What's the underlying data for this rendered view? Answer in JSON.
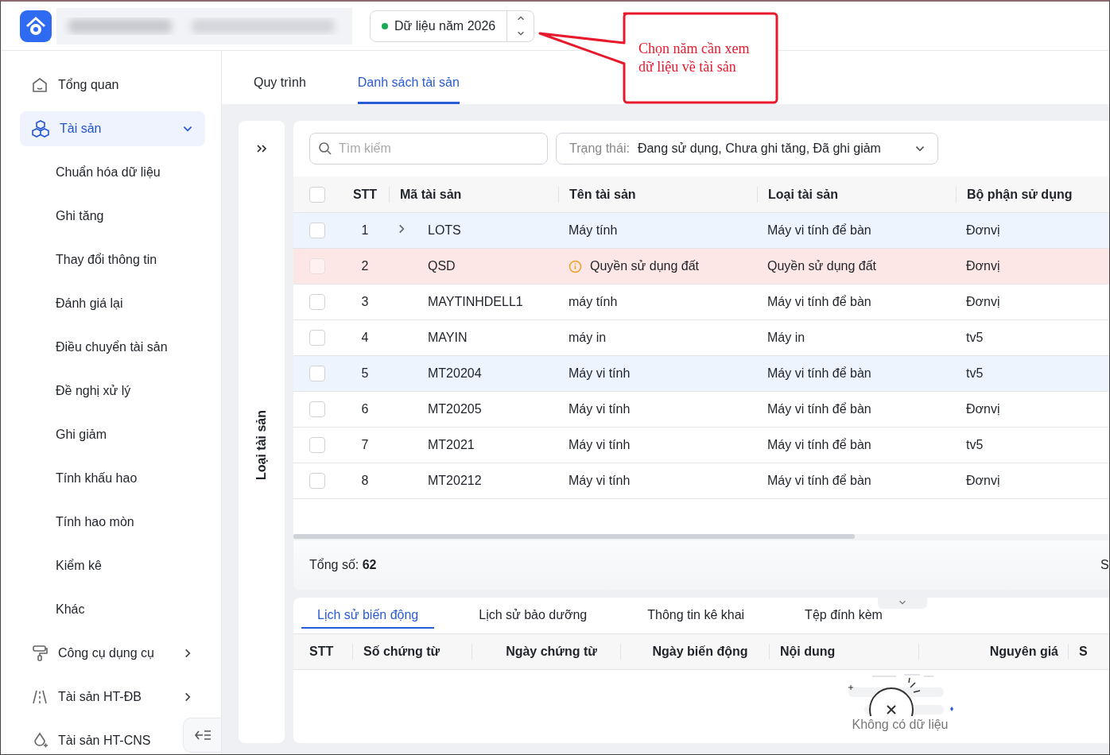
{
  "header": {
    "year_selector": {
      "label": "Dữ liệu năm 2026",
      "active": true
    }
  },
  "callout": {
    "text": "Chọn năm cần xem dữ liệu về tài sản"
  },
  "sidebar": {
    "items": [
      {
        "label": "Tổng quan",
        "selected": false
      },
      {
        "label": "Tài sản",
        "selected": true,
        "expanded": true,
        "children": [
          {
            "label": "Chuẩn hóa dữ liệu"
          },
          {
            "label": "Ghi tăng"
          },
          {
            "label": "Thay đổi thông tin"
          },
          {
            "label": "Đánh giá lại"
          },
          {
            "label": "Điều chuyển tài sản"
          },
          {
            "label": "Đề nghị xử lý"
          },
          {
            "label": "Ghi giảm"
          },
          {
            "label": "Tính khấu hao"
          },
          {
            "label": "Tính hao mòn"
          },
          {
            "label": "Kiểm kê"
          },
          {
            "label": "Khác"
          }
        ]
      },
      {
        "label": "Công cụ dụng cụ",
        "selected": false,
        "expanded": false
      },
      {
        "label": "Tài sản HT-ĐB",
        "selected": false,
        "expanded": false
      },
      {
        "label": "Tài sản HT-CNS",
        "selected": false
      }
    ]
  },
  "tabs": [
    {
      "label": "Quy trình",
      "selected": false
    },
    {
      "label": "Danh sách tài sản",
      "selected": true
    }
  ],
  "side_panel": {
    "title": "Loại tài sản"
  },
  "toolbar": {
    "search": {
      "placeholder": "Tìm kiếm"
    },
    "filter": {
      "label": "Trạng thái:",
      "value": "Đang sử dụng, Chưa ghi tăng, Đã ghi giảm"
    }
  },
  "table": {
    "select_all": {
      "checked": false
    },
    "columns": [
      "STT",
      "Mã tài sản",
      "Tên tài sản",
      "Loại tài sản",
      "Bộ phận sử dụng"
    ],
    "rows": [
      {
        "stt": "1",
        "code": "LOTS",
        "name": "Máy tính",
        "type": "Máy vi tính để bàn",
        "dept": "Đơnvị",
        "selected": true,
        "warning": false,
        "expandable": true
      },
      {
        "stt": "2",
        "code": "QSD",
        "name": "Quyền sử dụng đất",
        "type": "Quyền sử dụng đất",
        "dept": "Đơnvị",
        "selected": false,
        "warning": true,
        "expandable": false
      },
      {
        "stt": "3",
        "code": "MAYTINHDELL1",
        "name": "máy tính",
        "type": "Máy vi tính để bàn",
        "dept": "Đơnvị",
        "selected": false,
        "warning": false,
        "expandable": false
      },
      {
        "stt": "4",
        "code": "MAYIN",
        "name": "máy in",
        "type": "Máy in",
        "dept": "tv5",
        "selected": false,
        "warning": false,
        "expandable": false
      },
      {
        "stt": "5",
        "code": "MT20204",
        "name": "Máy vi tính",
        "type": "Máy vi tính để bàn",
        "dept": "tv5",
        "selected": true,
        "warning": false,
        "expandable": false
      },
      {
        "stt": "6",
        "code": "MT20205",
        "name": "Máy vi tính",
        "type": "Máy vi tính để bàn",
        "dept": "Đơnvị",
        "selected": false,
        "warning": false,
        "expandable": false
      },
      {
        "stt": "7",
        "code": "MT2021",
        "name": "Máy vi tính",
        "type": "Máy vi tính để bàn",
        "dept": "tv5",
        "selected": false,
        "warning": false,
        "expandable": false
      },
      {
        "stt": "8",
        "code": "MT20212",
        "name": "Máy vi tính",
        "type": "Máy vi tính để bàn",
        "dept": "Đơnvị",
        "selected": false,
        "warning": false,
        "expandable": false
      }
    ],
    "footer": {
      "total_label": "Tổng số:",
      "total": "62",
      "column_right": "S"
    }
  },
  "detail": {
    "tabs": [
      {
        "label": "Lịch sử biến động",
        "selected": true
      },
      {
        "label": "Lịch sử bảo dưỡng",
        "selected": false
      },
      {
        "label": "Thông tin kê khai",
        "selected": false
      },
      {
        "label": "Tệp đính kèm",
        "selected": false
      }
    ],
    "columns": [
      "STT",
      "Số chứng từ",
      "Ngày chứng từ",
      "Ngày biến động",
      "Nội dung",
      "Nguyên giá",
      "S"
    ],
    "empty_text": "Không có dữ liệu"
  }
}
